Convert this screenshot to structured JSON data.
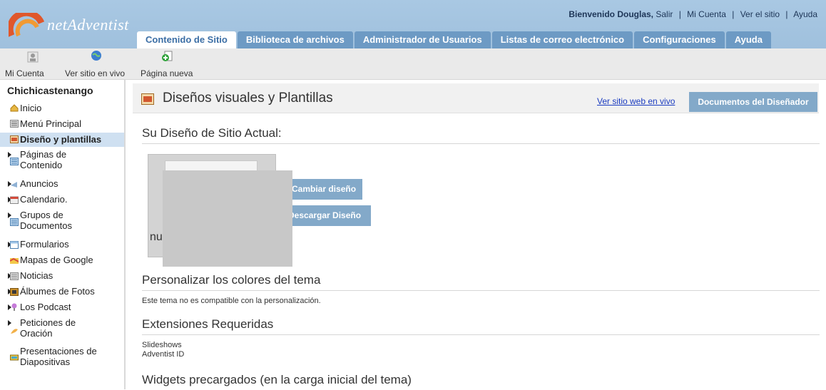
{
  "brand": {
    "name": "netAdventist"
  },
  "userbar": {
    "welcome": "Bienvenido Douglas,",
    "logout": "Salir",
    "my_account": "Mi Cuenta",
    "view_site": "Ver el sitio",
    "help": "Ayuda"
  },
  "tabs": [
    {
      "label": "Contenido de Sitio",
      "active": true
    },
    {
      "label": "Biblioteca de archivos"
    },
    {
      "label": "Administrador de Usuarios"
    },
    {
      "label": "Listas de correo electrónico"
    },
    {
      "label": "Configuraciones"
    },
    {
      "label": "Ayuda"
    }
  ],
  "iconbar": {
    "my_account": "Mi Cuenta",
    "view_live": "Ver sitio en vivo",
    "new_page": "Página nueva"
  },
  "sidebar": {
    "site_title": "Chichicastenango",
    "items": [
      {
        "label": "Inicio",
        "icon": "home-icon"
      },
      {
        "label": "Menú Principal",
        "icon": "menu-icon"
      },
      {
        "label": "Diseño y plantillas",
        "icon": "design-icon",
        "active": true
      },
      {
        "label1": "Páginas de",
        "label2": "Contenido",
        "icon": "pages-icon"
      },
      {
        "label": "Anuncios",
        "icon": "announce-icon"
      },
      {
        "label": "Calendario.",
        "icon": "calendar-icon"
      },
      {
        "label1": "Grupos de",
        "label2": "Documentos",
        "icon": "documents-icon"
      },
      {
        "label": "Formularios",
        "icon": "forms-icon"
      },
      {
        "label": "Mapas de Google",
        "icon": "map-icon"
      },
      {
        "label": "Noticias",
        "icon": "news-icon"
      },
      {
        "label": "Álbumes de Fotos",
        "icon": "photo-album-icon"
      },
      {
        "label": "Los Podcast",
        "icon": "podcast-icon"
      },
      {
        "label1": "Peticiones de",
        "label2": "Oración",
        "icon": "prayer-icon"
      },
      {
        "label1": "Presentaciones de",
        "label2": "Diapositivas",
        "icon": "slideshow-icon"
      }
    ]
  },
  "main": {
    "title": "Diseños visuales y Plantillas",
    "live_link": "Ver sitio web en vivo",
    "designer_button": "Documentos del Diseñador",
    "current_design_heading": "Su Diseño de Sitio Actual:",
    "change_design": "Cambiar diseño",
    "download_design": "Descargar Diseño",
    "thumb_caption": "nu",
    "customize_heading": "Personalizar los colores del tema",
    "customize_note": "Este tema no es compatible con la personalización.",
    "extensions_heading": "Extensiones Requeridas",
    "extensions": [
      "Slideshows",
      "Adventist ID"
    ],
    "widgets_heading": "Widgets precargados (en la carga inicial del tema)"
  },
  "colors": {
    "topbar": "#a9c8e3",
    "tab": "#6d9ac4",
    "button": "#83a9c9",
    "link": "#1a3bc0"
  }
}
